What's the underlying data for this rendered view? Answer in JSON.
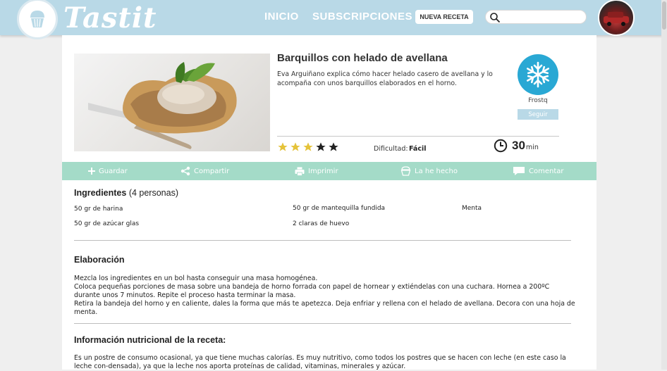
{
  "header": {
    "logo_text": "Tastit",
    "nav": [
      "INICIO",
      "SUBSCRIPCIONES"
    ],
    "new_recipe_label": "NUEVA RECETA",
    "search_placeholder": ""
  },
  "recipe": {
    "title": "Barquillos con helado de avellana",
    "description": "Eva Arguiñano explica cómo hacer helado casero de avellana y lo acompaña con unos barquillos elaborados en el horno.",
    "author": "Frostq",
    "follow_label": "Seguir",
    "rating": 3,
    "rating_max": 5,
    "difficulty_label": "Dificultad:",
    "difficulty_value": "Fácil",
    "time_value": "30",
    "time_unit": "min"
  },
  "actions": [
    "Guardar",
    "Compartir",
    "Imprimir",
    "La he hecho",
    "Comentar"
  ],
  "ingredients": {
    "title": "Ingredientes",
    "servings": "(4 personas)",
    "items": [
      "50 gr de harina",
      "50 gr de azúcar glas",
      "50 gr de mantequilla fundida",
      "2 claras de huevo",
      "Menta"
    ]
  },
  "elaboration": {
    "title": "Elaboración",
    "lines": [
      "Mezcla los ingredientes en un bol hasta conseguir una masa homogénea.",
      "Coloca pequeñas porciones de masa sobre una bandeja de horno forrada con papel de hornear y extiéndelas con una cuchara. Hornea a 200ºC durante unos 7 minutos. Repite el proceso hasta terminar la masa.",
      "Retira la bandeja del horno y en caliente, dales la forma que más te apetezca. Deja enfriar y rellena con el helado de avellana. Decora con una hoja de menta."
    ]
  },
  "nutrition": {
    "title": "Información nutricional de la receta:",
    "text": "Es un postre de consumo ocasional, ya que tiene muchas calorías. Es muy nutritivo, como todos los postres que se hacen con leche (en este caso la leche con-densada), ya que la leche nos aporta proteínas de calidad, vitaminas, minerales y azúcar."
  },
  "colors": {
    "header_bg": "#b9d9e7",
    "action_bar": "#a4dbc8",
    "author_badge": "#29a8d4",
    "star_filled": "#e5c33a",
    "star_empty": "#222222"
  }
}
